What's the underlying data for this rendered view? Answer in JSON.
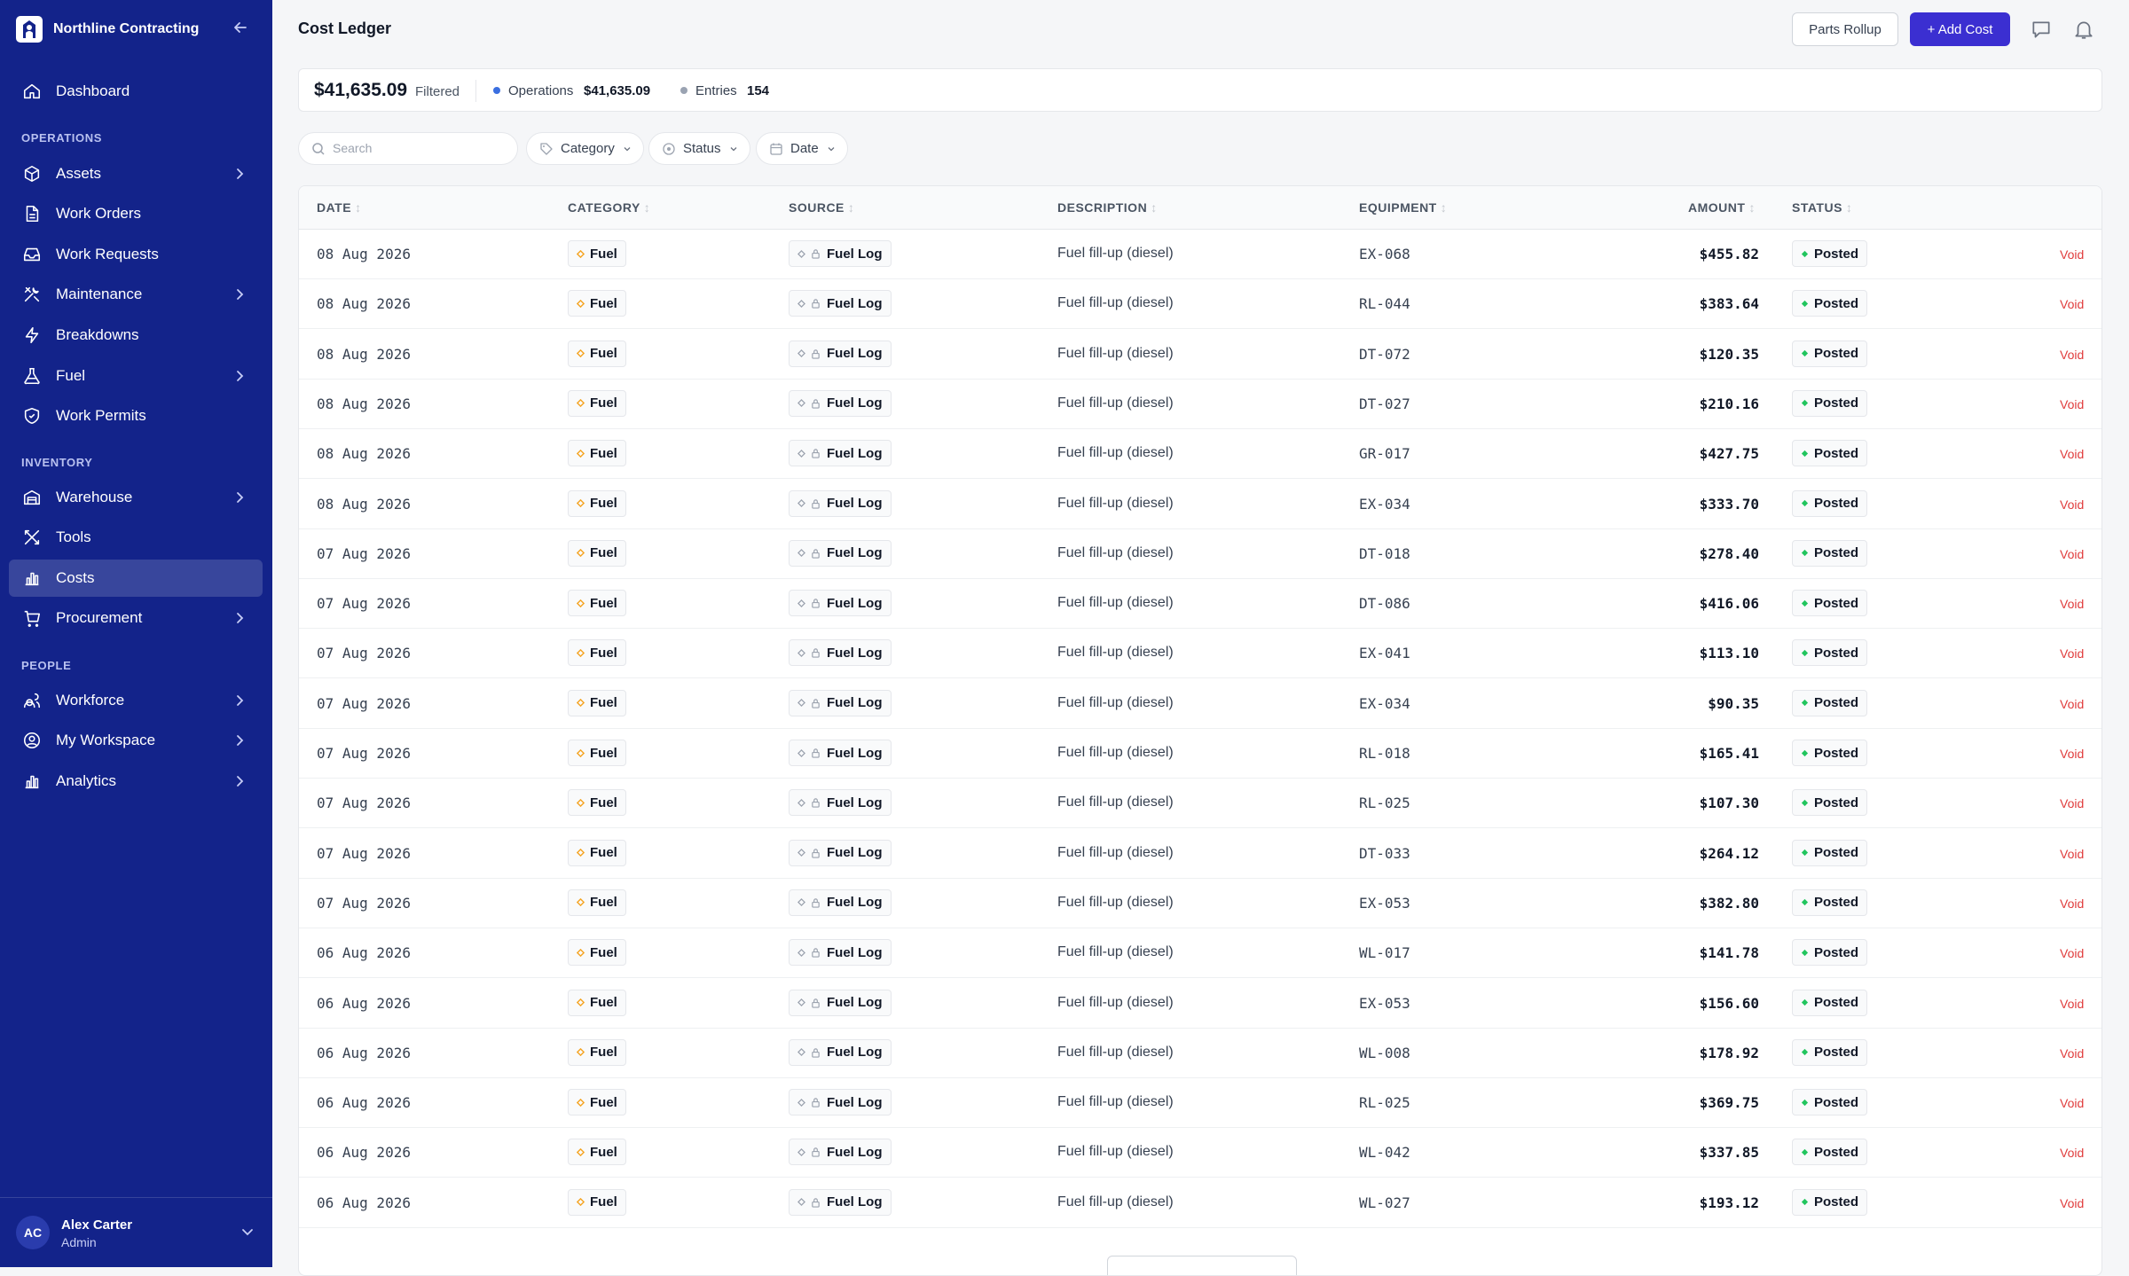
{
  "sidebar": {
    "brand": "Northline Contracting",
    "dashboard": "Dashboard",
    "sections": {
      "operations": "OPERATIONS",
      "inventory": "INVENTORY",
      "people": "PEOPLE"
    },
    "items": [
      {
        "label": "Assets"
      },
      {
        "label": "Work Orders"
      },
      {
        "label": "Work Requests"
      },
      {
        "label": "Maintenance"
      },
      {
        "label": "Breakdowns"
      },
      {
        "label": "Fuel"
      },
      {
        "label": "Work Permits"
      },
      {
        "label": "Warehouse"
      },
      {
        "label": "Tools"
      },
      {
        "label": "Costs"
      },
      {
        "label": "Procurement"
      },
      {
        "label": "Workforce"
      },
      {
        "label": "My Workspace"
      },
      {
        "label": "Analytics"
      }
    ],
    "user": {
      "initials": "AC",
      "name": "Alex Carter",
      "role": "Admin"
    }
  },
  "header": {
    "title": "Cost Ledger",
    "parts_rollup": "Parts Rollup",
    "add_cost": "+ Add Cost"
  },
  "summary": {
    "total": "$41,635.09",
    "filtered": "Filtered",
    "operations_label": "Operations",
    "operations_value": "$41,635.09",
    "entries_label": "Entries",
    "entries_value": "154"
  },
  "filters": {
    "search_placeholder": "Search",
    "category": "Category",
    "status": "Status",
    "date": "Date"
  },
  "table": {
    "columns": [
      "DATE",
      "CATEGORY",
      "SOURCE",
      "DESCRIPTION",
      "EQUIPMENT",
      "AMOUNT",
      "STATUS"
    ],
    "rows": [
      {
        "date": "08 Aug 2026",
        "category": "Fuel",
        "source": "Fuel Log",
        "description": "Fuel fill-up (diesel)",
        "equipment": "EX-068",
        "amount": "$455.82",
        "status": "Posted",
        "action": "Void"
      },
      {
        "date": "08 Aug 2026",
        "category": "Fuel",
        "source": "Fuel Log",
        "description": "Fuel fill-up (diesel)",
        "equipment": "RL-044",
        "amount": "$383.64",
        "status": "Posted",
        "action": "Void"
      },
      {
        "date": "08 Aug 2026",
        "category": "Fuel",
        "source": "Fuel Log",
        "description": "Fuel fill-up (diesel)",
        "equipment": "DT-072",
        "amount": "$120.35",
        "status": "Posted",
        "action": "Void"
      },
      {
        "date": "08 Aug 2026",
        "category": "Fuel",
        "source": "Fuel Log",
        "description": "Fuel fill-up (diesel)",
        "equipment": "DT-027",
        "amount": "$210.16",
        "status": "Posted",
        "action": "Void"
      },
      {
        "date": "08 Aug 2026",
        "category": "Fuel",
        "source": "Fuel Log",
        "description": "Fuel fill-up (diesel)",
        "equipment": "GR-017",
        "amount": "$427.75",
        "status": "Posted",
        "action": "Void"
      },
      {
        "date": "08 Aug 2026",
        "category": "Fuel",
        "source": "Fuel Log",
        "description": "Fuel fill-up (diesel)",
        "equipment": "EX-034",
        "amount": "$333.70",
        "status": "Posted",
        "action": "Void"
      },
      {
        "date": "07 Aug 2026",
        "category": "Fuel",
        "source": "Fuel Log",
        "description": "Fuel fill-up (diesel)",
        "equipment": "DT-018",
        "amount": "$278.40",
        "status": "Posted",
        "action": "Void"
      },
      {
        "date": "07 Aug 2026",
        "category": "Fuel",
        "source": "Fuel Log",
        "description": "Fuel fill-up (diesel)",
        "equipment": "DT-086",
        "amount": "$416.06",
        "status": "Posted",
        "action": "Void"
      },
      {
        "date": "07 Aug 2026",
        "category": "Fuel",
        "source": "Fuel Log",
        "description": "Fuel fill-up (diesel)",
        "equipment": "EX-041",
        "amount": "$113.10",
        "status": "Posted",
        "action": "Void"
      },
      {
        "date": "07 Aug 2026",
        "category": "Fuel",
        "source": "Fuel Log",
        "description": "Fuel fill-up (diesel)",
        "equipment": "EX-034",
        "amount": "$90.35",
        "status": "Posted",
        "action": "Void"
      },
      {
        "date": "07 Aug 2026",
        "category": "Fuel",
        "source": "Fuel Log",
        "description": "Fuel fill-up (diesel)",
        "equipment": "RL-018",
        "amount": "$165.41",
        "status": "Posted",
        "action": "Void"
      },
      {
        "date": "07 Aug 2026",
        "category": "Fuel",
        "source": "Fuel Log",
        "description": "Fuel fill-up (diesel)",
        "equipment": "RL-025",
        "amount": "$107.30",
        "status": "Posted",
        "action": "Void"
      },
      {
        "date": "07 Aug 2026",
        "category": "Fuel",
        "source": "Fuel Log",
        "description": "Fuel fill-up (diesel)",
        "equipment": "DT-033",
        "amount": "$264.12",
        "status": "Posted",
        "action": "Void"
      },
      {
        "date": "07 Aug 2026",
        "category": "Fuel",
        "source": "Fuel Log",
        "description": "Fuel fill-up (diesel)",
        "equipment": "EX-053",
        "amount": "$382.80",
        "status": "Posted",
        "action": "Void"
      },
      {
        "date": "06 Aug 2026",
        "category": "Fuel",
        "source": "Fuel Log",
        "description": "Fuel fill-up (diesel)",
        "equipment": "WL-017",
        "amount": "$141.78",
        "status": "Posted",
        "action": "Void"
      },
      {
        "date": "06 Aug 2026",
        "category": "Fuel",
        "source": "Fuel Log",
        "description": "Fuel fill-up (diesel)",
        "equipment": "EX-053",
        "amount": "$156.60",
        "status": "Posted",
        "action": "Void"
      },
      {
        "date": "06 Aug 2026",
        "category": "Fuel",
        "source": "Fuel Log",
        "description": "Fuel fill-up (diesel)",
        "equipment": "WL-008",
        "amount": "$178.92",
        "status": "Posted",
        "action": "Void"
      },
      {
        "date": "06 Aug 2026",
        "category": "Fuel",
        "source": "Fuel Log",
        "description": "Fuel fill-up (diesel)",
        "equipment": "RL-025",
        "amount": "$369.75",
        "status": "Posted",
        "action": "Void"
      },
      {
        "date": "06 Aug 2026",
        "category": "Fuel",
        "source": "Fuel Log",
        "description": "Fuel fill-up (diesel)",
        "equipment": "WL-042",
        "amount": "$337.85",
        "status": "Posted",
        "action": "Void"
      },
      {
        "date": "06 Aug 2026",
        "category": "Fuel",
        "source": "Fuel Log",
        "description": "Fuel fill-up (diesel)",
        "equipment": "WL-027",
        "amount": "$193.12",
        "status": "Posted",
        "action": "Void"
      }
    ]
  },
  "colors": {
    "sidebar_bg": "#13238a",
    "primary": "#3b2fd1",
    "category_dot": "#f5a524",
    "status_dot": "#22c55e",
    "void": "#e03c3c",
    "operations_dot": "#3b6fe0",
    "entries_dot": "#9aa3b2"
  }
}
